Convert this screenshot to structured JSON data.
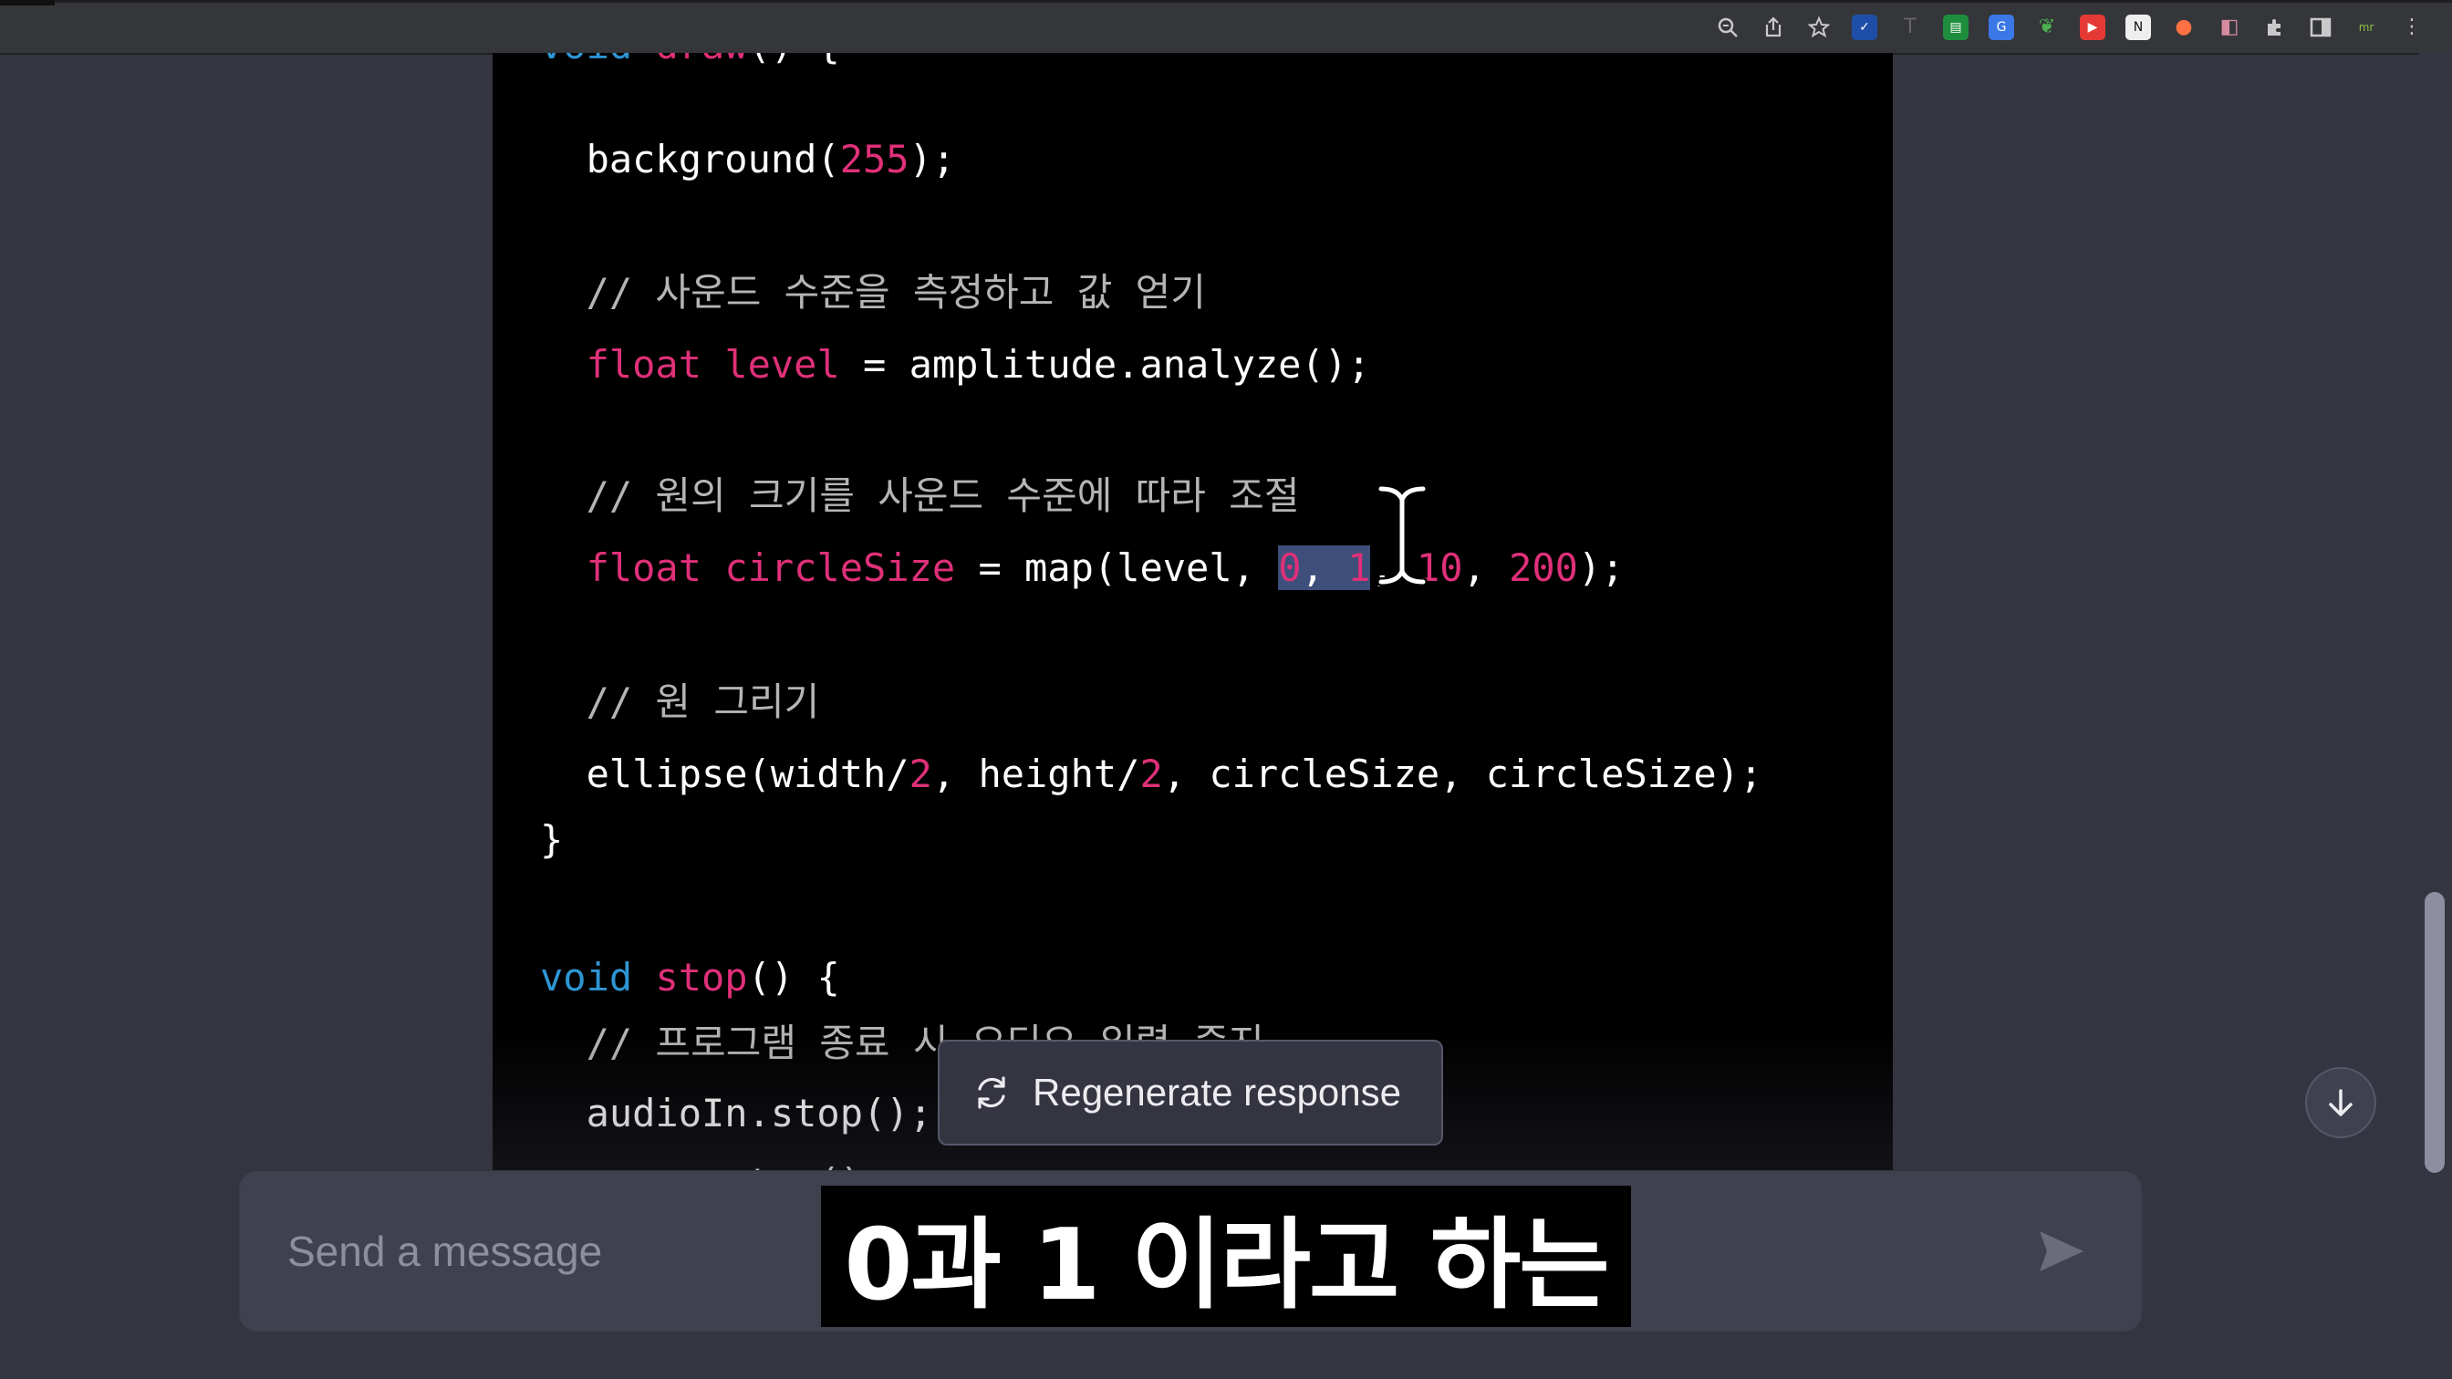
{
  "browser": {
    "extension_icons": [
      "zoom-icon",
      "share-icon",
      "star-icon",
      "checkbox-ext-icon",
      "t-ext-icon",
      "sheet-ext-icon",
      "translate-ext-icon",
      "leaf-ext-icon",
      "record-ext-icon",
      "notion-ext-icon",
      "fire-ext-icon",
      "split-ext-icon",
      "puzzle-icon",
      "sidepanel-icon",
      "mr-ext-icon",
      "menu-dots-icon"
    ]
  },
  "code": {
    "lines": [
      {
        "id": "l0",
        "parts": [
          {
            "t": "void",
            "c": "kw"
          },
          {
            "t": " "
          },
          {
            "t": "draw",
            "c": "fn"
          },
          {
            "t": "() {"
          }
        ]
      },
      {
        "id": "l1",
        "parts": [
          {
            "t": "  background("
          },
          {
            "t": "255",
            "c": "num"
          },
          {
            "t": ");"
          }
        ]
      },
      {
        "id": "l2",
        "parts": [
          {
            "t": ""
          }
        ]
      },
      {
        "id": "l3",
        "parts": [
          {
            "t": "  // 사운드 수준을 측정하고 값 얻기",
            "c": "cm"
          }
        ]
      },
      {
        "id": "l4",
        "parts": [
          {
            "t": "  "
          },
          {
            "t": "float",
            "c": "fn"
          },
          {
            "t": " "
          },
          {
            "t": "level",
            "c": "fn"
          },
          {
            "t": " = amplitude.analyze();"
          }
        ]
      },
      {
        "id": "l5",
        "parts": [
          {
            "t": ""
          }
        ]
      },
      {
        "id": "l6",
        "parts": [
          {
            "t": "  // 원의 크기를 사운드 수준에 따라 조절",
            "c": "cm"
          }
        ]
      },
      {
        "id": "l7",
        "parts": [
          {
            "t": "  "
          },
          {
            "t": "float",
            "c": "fn"
          },
          {
            "t": " "
          },
          {
            "t": "circleSize",
            "c": "fn"
          },
          {
            "t": " = map(level, "
          },
          {
            "t": "0",
            "c": "num sel"
          },
          {
            "t": ", ",
            "c": "sel"
          },
          {
            "t": "1",
            "c": "num sel"
          },
          {
            "t": ", "
          },
          {
            "t": "10",
            "c": "num"
          },
          {
            "t": ", "
          },
          {
            "t": "200",
            "c": "num"
          },
          {
            "t": ");"
          }
        ]
      },
      {
        "id": "l8",
        "parts": [
          {
            "t": ""
          }
        ]
      },
      {
        "id": "l9",
        "parts": [
          {
            "t": "  // 원 그리기",
            "c": "cm"
          }
        ]
      },
      {
        "id": "l10",
        "parts": [
          {
            "t": "  ellipse(width/"
          },
          {
            "t": "2",
            "c": "num"
          },
          {
            "t": ", height/"
          },
          {
            "t": "2",
            "c": "num"
          },
          {
            "t": ", circleSize, circleSize);"
          }
        ]
      },
      {
        "id": "l11",
        "parts": [
          {
            "t": "}"
          }
        ]
      },
      {
        "id": "l12",
        "parts": [
          {
            "t": ""
          }
        ]
      },
      {
        "id": "l13",
        "parts": [
          {
            "t": ""
          }
        ]
      },
      {
        "id": "l14",
        "parts": [
          {
            "t": "void",
            "c": "kw"
          },
          {
            "t": " "
          },
          {
            "t": "stop",
            "c": "fn"
          },
          {
            "t": "() {"
          }
        ]
      },
      {
        "id": "l15",
        "parts": [
          {
            "t": "  // 프로그램 종료 시 오디오 입력 중지",
            "c": "cm"
          }
        ]
      },
      {
        "id": "l16",
        "parts": [
          {
            "t": "  audioIn.stop();"
          }
        ]
      },
      {
        "id": "l17",
        "parts": [
          {
            "t": "  "
          },
          {
            "t": "super",
            "c": "sup"
          },
          {
            "t": ".stop();"
          }
        ]
      }
    ]
  },
  "regenerate": {
    "label": "Regenerate response",
    "icon": "refresh-icon"
  },
  "composer": {
    "placeholder": "Send a message",
    "send_icon": "send-icon"
  },
  "scroll_down": {
    "icon": "arrow-down-icon"
  },
  "caption": {
    "text": "0과 1 이라고 하는"
  },
  "colors": {
    "keyword": "#2e95d3",
    "function": "#df3079",
    "comment": "#b5b5b5",
    "super": "#e9950c",
    "background": "#343541",
    "code_bg": "#000000"
  }
}
